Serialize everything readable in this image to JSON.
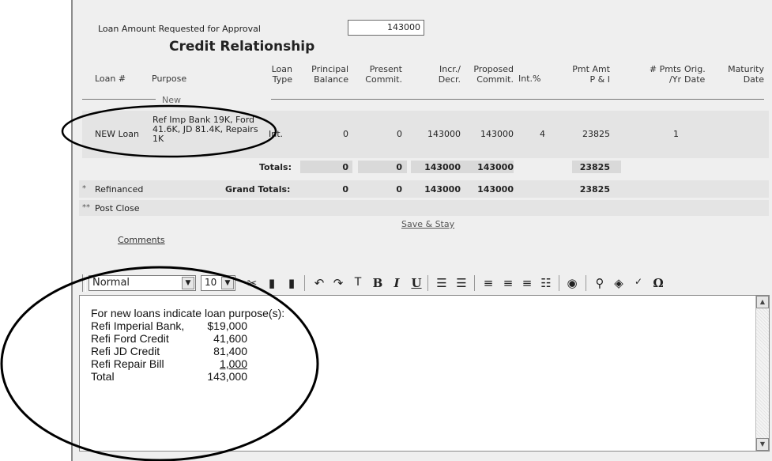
{
  "loan_request": {
    "label": "Loan Amount Requested for Approval",
    "value": "143000"
  },
  "section_title": "Credit Relationship",
  "columns": {
    "loan_num": "Loan #",
    "purpose": "Purpose",
    "loan_type": [
      "Loan",
      "Type"
    ],
    "principal": [
      "Principal",
      "Balance"
    ],
    "present": [
      "Present",
      "Commit."
    ],
    "incr": [
      "Incr./",
      "Decr."
    ],
    "proposed": [
      "Proposed",
      "Commit."
    ],
    "int": "Int.%",
    "pmt": [
      "Pmt Amt",
      "P & I"
    ],
    "pmts_yr": [
      "# Pmts",
      "/Yr"
    ],
    "orig": [
      "Orig.",
      "Date"
    ],
    "maturity": [
      "Maturity",
      "Date"
    ]
  },
  "new_label": "New",
  "loan_row": {
    "loan_num": "NEW Loan",
    "purpose": [
      "Ref Imp Bank 19K, Ford",
      "41.6K, JD 81.4K, Repairs",
      "1K"
    ],
    "loan_type": "Int.",
    "principal": "0",
    "present": "0",
    "incr": "143000",
    "proposed": "143000",
    "int": "4",
    "pmt": "23825",
    "pmts_yr": "1",
    "orig": "",
    "maturity": ""
  },
  "totals": {
    "label": "Totals:",
    "principal": "0",
    "present": "0",
    "incr": "143000",
    "proposed": "143000",
    "pmt": "23825"
  },
  "grand_totals": {
    "label": "Grand Totals:",
    "principal": "0",
    "present": "0",
    "incr": "143000",
    "proposed": "143000",
    "pmt": "23825"
  },
  "refinanced": {
    "marker": "*",
    "label": "Refinanced"
  },
  "post_close": {
    "marker": "**",
    "label": "Post Close"
  },
  "save_stay": "Save & Stay",
  "comments_link": "Comments",
  "toolbar": {
    "style_value": "Normal",
    "size_value": "10",
    "icons": [
      "cut-icon",
      "copy-icon",
      "paste-icon",
      "undo-icon",
      "redo-icon",
      "clear-format-icon",
      "bold-icon",
      "italic-icon",
      "underline-icon",
      "outdent-icon",
      "indent-icon",
      "align-left-icon",
      "align-center-icon",
      "align-right-icon",
      "bullet-list-icon",
      "insert-image-icon",
      "find-icon",
      "spell-check-icon",
      "abc-check-icon",
      "special-char-icon"
    ]
  },
  "editor": {
    "intro": "For new loans indicate loan purpose(s):",
    "lines": [
      {
        "label": "Refi Imperial Bank,",
        "amount": "$19,000"
      },
      {
        "label": "Refi Ford Credit",
        "amount": "41,600"
      },
      {
        "label": "Refi JD Credit",
        "amount": "81,400"
      },
      {
        "label": "Refi Repair Bill",
        "amount": "1,000"
      },
      {
        "label": "Total",
        "amount": "143,000"
      }
    ]
  }
}
